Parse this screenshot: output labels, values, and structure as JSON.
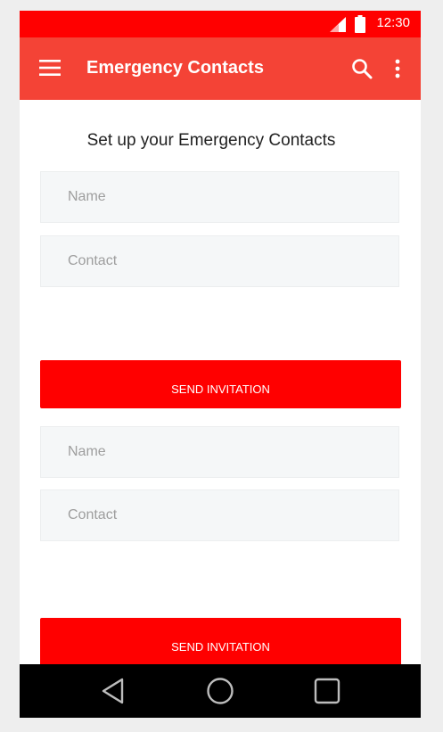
{
  "status_bar": {
    "time": "12:30",
    "signal_icon": "signal-icon",
    "battery_icon": "battery-icon"
  },
  "app_bar": {
    "title": "Emergency Contacts",
    "menu_icon": "menu-icon",
    "search_icon": "search-icon",
    "more_icon": "more-vert-icon"
  },
  "main": {
    "heading": "Set up your Emergency Contacts",
    "contacts": [
      {
        "name_placeholder": "Name",
        "name_value": "",
        "contact_placeholder": "Contact",
        "contact_value": "",
        "button_label": "SEND INVITATION"
      },
      {
        "name_placeholder": "Name",
        "name_value": "",
        "contact_placeholder": "Contact",
        "contact_value": "",
        "button_label": "SEND INVITATION"
      }
    ]
  },
  "nav_bar": {
    "back_icon": "back-icon",
    "home_icon": "home-icon",
    "recents_icon": "recents-icon"
  },
  "colors": {
    "status_bar": "#ff0000",
    "app_bar": "#f44336",
    "button": "#ff0000",
    "field_background": "#f5f7f8",
    "nav_bar": "#000000"
  }
}
